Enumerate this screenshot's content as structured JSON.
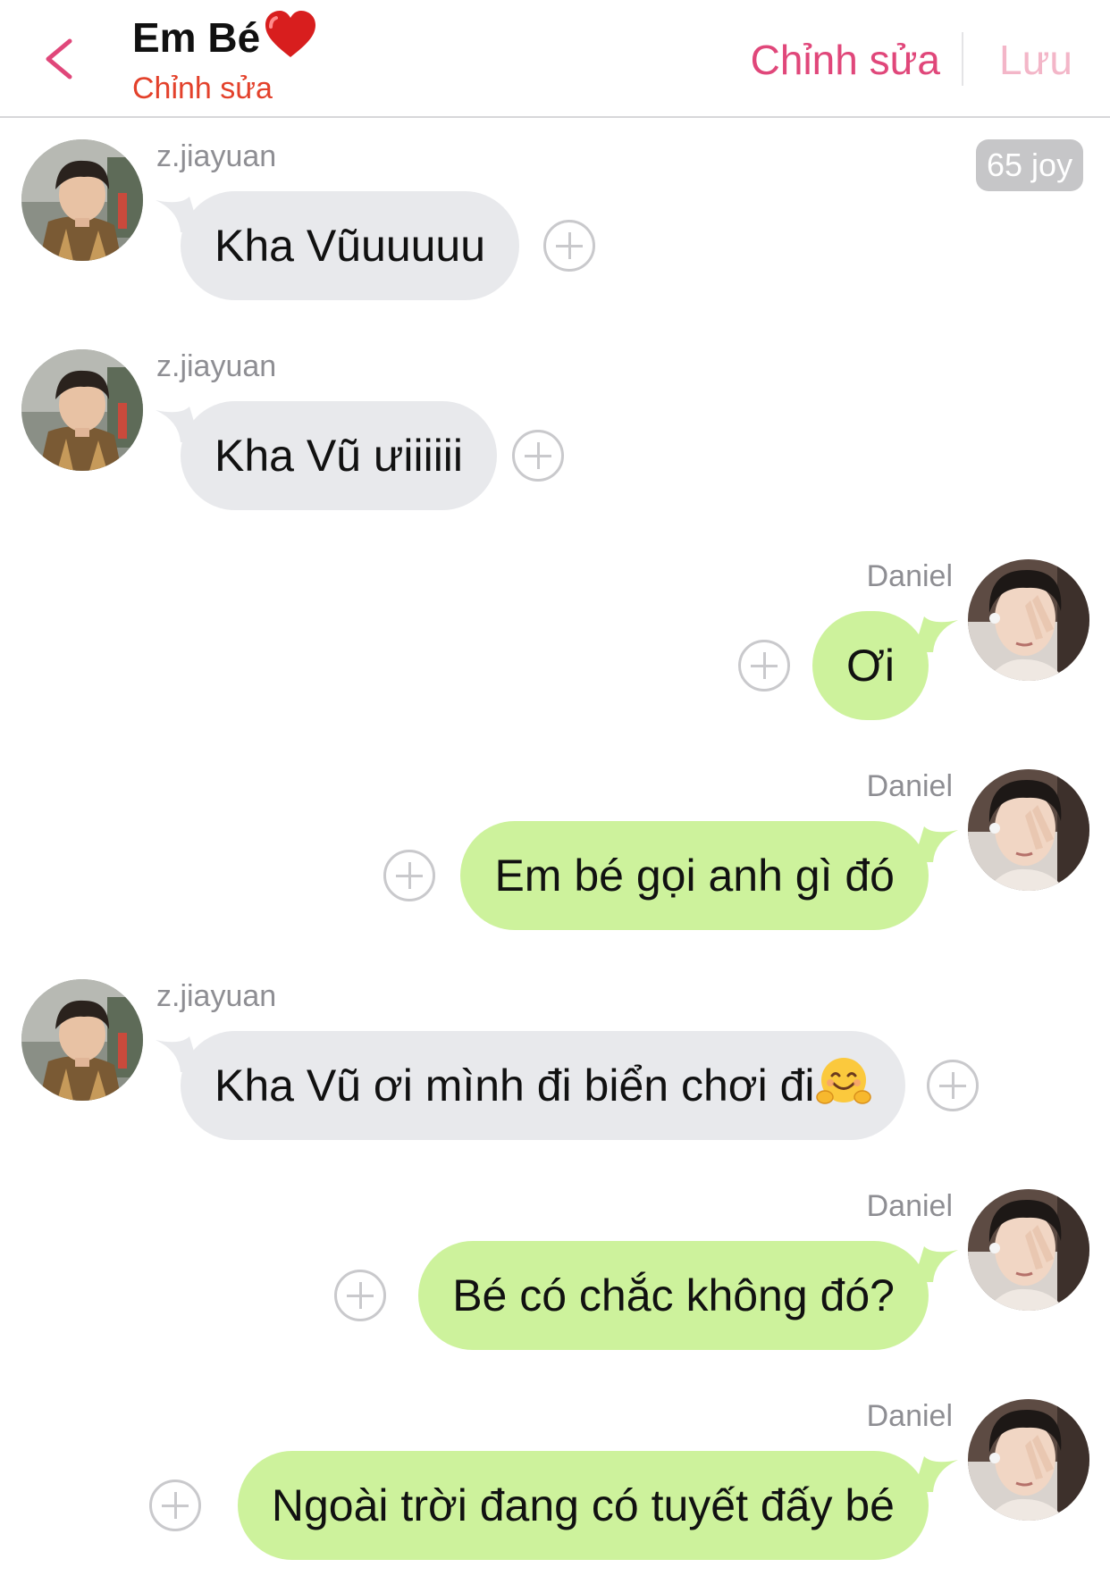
{
  "header": {
    "title": "Em Bé",
    "subtitle": "Chỉnh sửa",
    "edit_label": "Chỉnh sửa",
    "save_label": "Lưu"
  },
  "joy_badge": "65 joy",
  "colors": {
    "accent": "#e0477a",
    "subtitle": "#e3412b",
    "incoming_bubble": "#e8e9ec",
    "outgoing_bubble": "#cdf29c",
    "badge": "#c6c6c8"
  },
  "messages": [
    {
      "sender": "z.jiayuan",
      "text": "Kha Vũuuuuu"
    },
    {
      "sender": "z.jiayuan",
      "text": "Kha Vũ ưiiiiii"
    },
    {
      "sender": "Daniel",
      "text": "Ơi"
    },
    {
      "sender": "Daniel",
      "text": "Em bé gọi anh gì đó"
    },
    {
      "sender": "z.jiayuan",
      "text": "Kha Vũ ơi mình đi biển chơi đi"
    },
    {
      "sender": "Daniel",
      "text": "Bé có chắc không đó?"
    },
    {
      "sender": "Daniel",
      "text": "Ngoài trời đang có tuyết đấy bé"
    }
  ]
}
